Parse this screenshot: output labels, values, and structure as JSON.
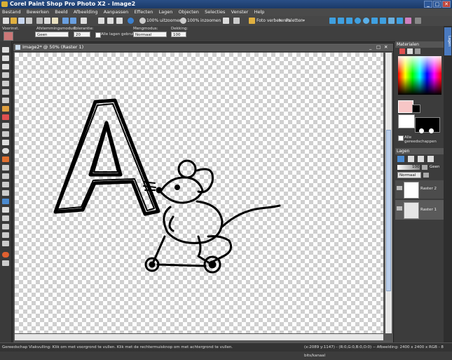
{
  "window": {
    "title": "Corel Paint Shop Pro Photo X2 - Image2",
    "min": "_",
    "max": "□",
    "close": "✕"
  },
  "menu": [
    "Bestand",
    "Bewerken",
    "Beeld",
    "Afbeelding",
    "Aanpassen",
    "Effecten",
    "Lagen",
    "Objecten",
    "Selecties",
    "Venster",
    "Help"
  ],
  "toolbar": {
    "zoom_out": "100% uitzoomen",
    "zoom_in": "100% inzoomen",
    "enhance": "Foto verbeteren",
    "palettes": "Paletten"
  },
  "options": {
    "presets_label": "Voorinst.",
    "match_mode_label": "Afstemmingsmodus:",
    "match_mode_value": "Geen",
    "tolerance_label": "Tolerantie:",
    "tolerance_value": "20",
    "all_layers_label": "Alle lagen gebruiken",
    "blend_mode_label": "Mengmodus:",
    "blend_mode_value": "Normaal",
    "opacity_label": "Dekking:",
    "opacity_value": "100"
  },
  "document": {
    "title": "Image2* @  50% (Raster 1)"
  },
  "materials": {
    "title": "Materialen",
    "all_tools_label": "Alle gereedschappen"
  },
  "layers": {
    "title": "Lagen",
    "opacity_value": "100",
    "none_label": "Geen",
    "blend_value": "Normaal",
    "items": [
      {
        "name": "Raster 2"
      },
      {
        "name": "Raster 1"
      }
    ]
  },
  "side_strip_label": "Lagen",
  "status": {
    "left": "Gereedschap Vlakvulling: Klik om met voorgrond te vullen. Klik met de rechtermuisknop om met achtergrond te vullen.",
    "right": "(x:2089 y:1147) - (R:0,G:0,B:0,O:0) -- Afbeelding:  2400 x 2400 x RGB - 8 bits/kanaal"
  },
  "colors": {
    "foreground": "#f7c6c6",
    "background": "#000000",
    "accent": "#1b3a68"
  }
}
